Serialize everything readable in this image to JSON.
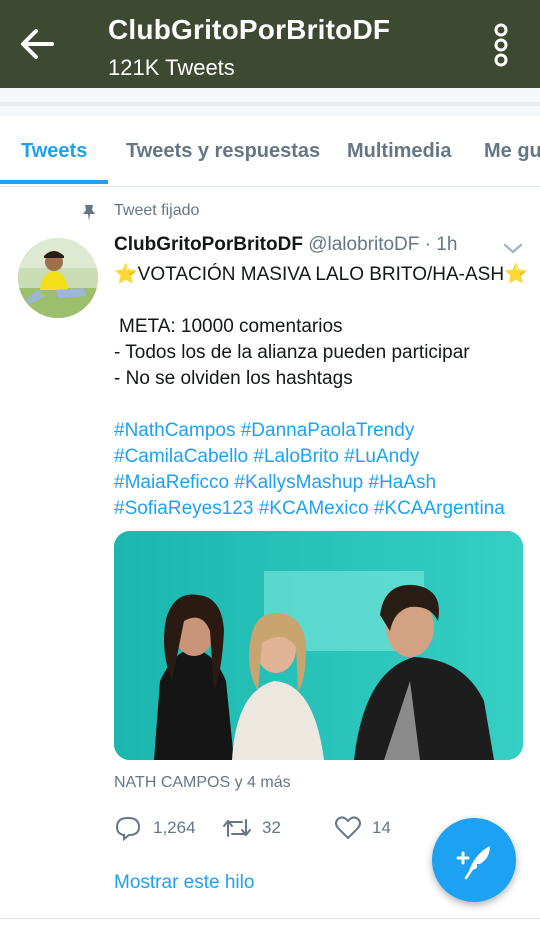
{
  "header": {
    "title": "ClubGritoPorBritoDF",
    "subtitle": "121K Tweets",
    "bg_color": "#3d4a31"
  },
  "tabs": [
    {
      "label": "Tweets",
      "active": true
    },
    {
      "label": "Tweets y respuestas",
      "active": false
    },
    {
      "label": "Multimedia",
      "active": false
    },
    {
      "label": "Me gu",
      "active": false
    }
  ],
  "tweet": {
    "pinned_label": "Tweet fijado",
    "display_name": "ClubGritoPorBritoDF",
    "handle": "@lalobritoDF",
    "separator": "·",
    "time": "1h",
    "star": "⭐",
    "headline": "VOTACIÓN MASIVA LALO BRITO/HA-ASH",
    "lines": [
      "META: 10000 comentarios",
      "- Todos los de la alianza pueden participar",
      "- No se olviden los hashtags"
    ],
    "hashtags": [
      "#NathCampos",
      "#DannaPaolaTrendy",
      "#CamilaCabello",
      "#LaloBrito",
      "#LuAndy",
      "#MaiaReficco",
      "#KallysMashup",
      "#HaAsh",
      "#SofiaReyes123",
      "#KCAMexico",
      "#KCAArgentina"
    ],
    "media_credit": "NATH CAMPOS y 4 más",
    "replies": "1,264",
    "retweets": "32",
    "likes": "14",
    "show_thread": "Mostrar este hilo"
  },
  "colors": {
    "accent": "#1da1f2",
    "muted": "#657786",
    "text": "#14171a"
  }
}
